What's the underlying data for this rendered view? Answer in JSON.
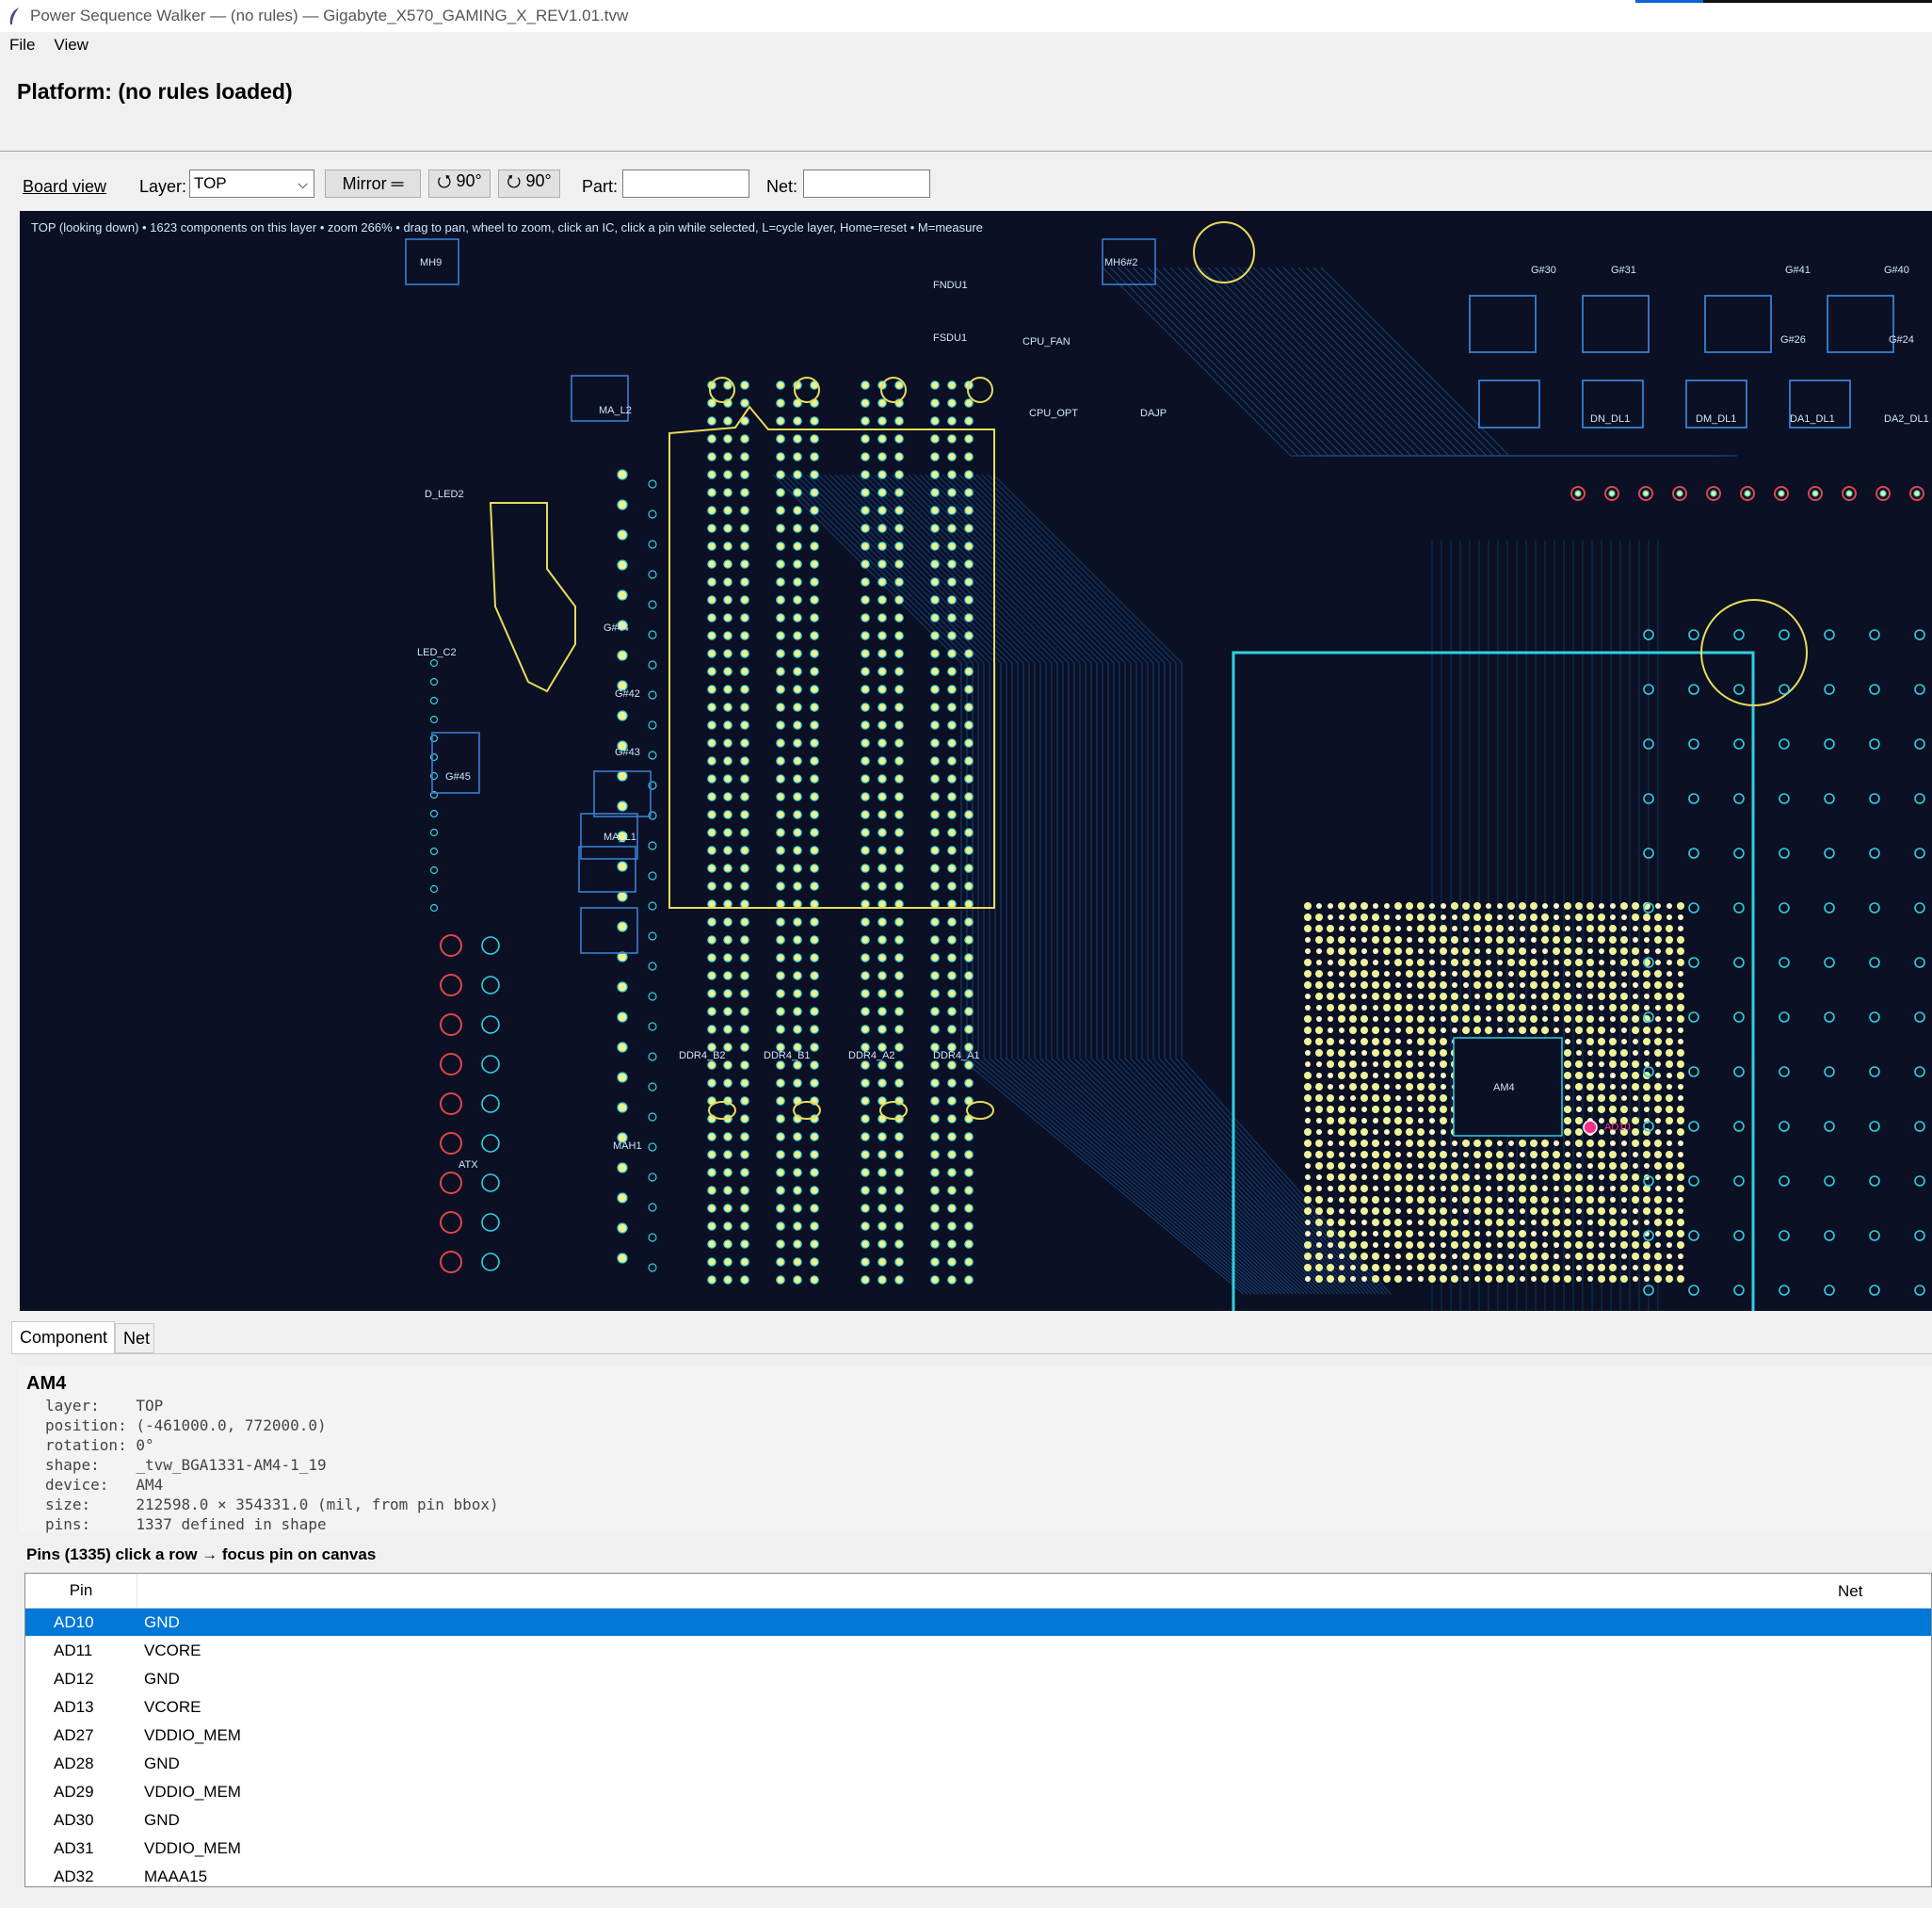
{
  "window": {
    "title": "Power Sequence Walker — (no rules) — Gigabyte_X570_GAMING_X_REV1.01.tvw"
  },
  "menu": [
    "File",
    "View"
  ],
  "platform_label": "Platform: (no rules loaded)",
  "toolbar": {
    "board_view": "Board view",
    "layer_label": "Layer:",
    "layer_value": "TOP",
    "mirror": "Mirror ═",
    "rot_ccw": "⭯ 90°",
    "rot_cw": "⭮ 90°",
    "part_label": "Part:",
    "part_value": "",
    "net_label": "Net:",
    "net_value": ""
  },
  "canvas": {
    "status": "TOP (looking down)  •  1623 components on this layer  •  zoom 266%  •  drag to pan, wheel to zoom, click an IC, click a pin while selected, L=cycle layer, Home=reset  •  M=measure",
    "labels": [
      "MH9",
      "MH6#2",
      "FNDU1",
      "FSDU1",
      "CPU_FAN",
      "CPU_OPT",
      "DAJP",
      "MA_L2",
      "G#44",
      "G#42",
      "G#43",
      "G#45",
      "MA_L1",
      "D_LED2",
      "LED_C2",
      "ATX",
      "DDR4_B2",
      "DDR4_B1",
      "DDR4_A2",
      "DDR4_A1",
      "AM4",
      "AD10",
      "G#30",
      "G#31",
      "G#41",
      "G#40",
      "DN_DL1",
      "DM_DL1",
      "DA1_DL1",
      "DA2_DL1",
      "G#26",
      "G#24",
      "MAH1"
    ],
    "colors": {
      "background": "#0b1024",
      "trace": "#1e6fb8",
      "pad": "#f3f08a",
      "cyan": "#2fd0e0",
      "outline": "#e8dc5a",
      "highlight": "#ff2e8a"
    }
  },
  "tabs": [
    "Component",
    "Net"
  ],
  "component": {
    "name": "AM4",
    "lines": [
      "layer:    TOP",
      "position: (-461000.0, 772000.0)",
      "rotation: 0°",
      "shape:    _tvw_BGA1331-AM4-1_19",
      "device:   AM4",
      "size:     212598.0 × 354331.0 (mil, from pin bbox)",
      "pins:     1337 defined in shape"
    ]
  },
  "pins_header": "Pins (1335)  click a row → focus pin on canvas",
  "pins_table": {
    "columns": [
      "Pin",
      "Net"
    ],
    "rows": [
      {
        "pin": "AD10",
        "net": "GND"
      },
      {
        "pin": "AD11",
        "net": "VCORE"
      },
      {
        "pin": "AD12",
        "net": "GND"
      },
      {
        "pin": "AD13",
        "net": "VCORE"
      },
      {
        "pin": "AD27",
        "net": "VDDIO_MEM"
      },
      {
        "pin": "AD28",
        "net": "GND"
      },
      {
        "pin": "AD29",
        "net": "VDDIO_MEM"
      },
      {
        "pin": "AD30",
        "net": "GND"
      },
      {
        "pin": "AD31",
        "net": "VDDIO_MEM"
      },
      {
        "pin": "AD32",
        "net": "MAAA15"
      }
    ],
    "selected": 0
  }
}
